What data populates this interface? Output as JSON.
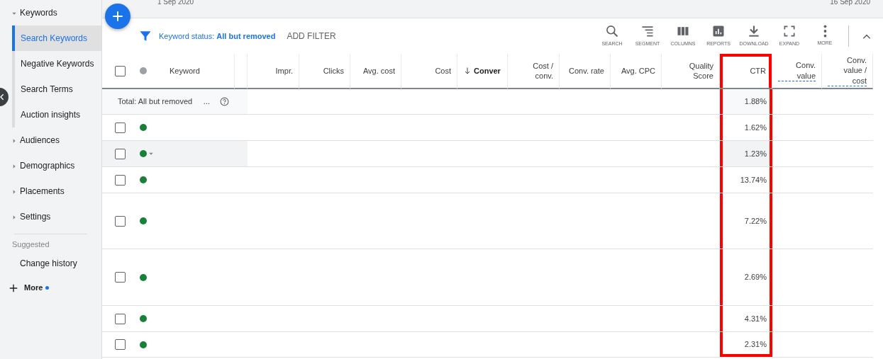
{
  "sidebar": {
    "items": [
      {
        "label": "Keywords",
        "expanded": true,
        "children": [
          {
            "label": "Search Keywords",
            "selected": true
          },
          {
            "label": "Negative Keywords",
            "selected": false
          },
          {
            "label": "Search Terms",
            "selected": false
          },
          {
            "label": "Auction insights",
            "selected": false
          }
        ]
      },
      {
        "label": "Audiences",
        "expanded": false
      },
      {
        "label": "Demographics",
        "expanded": false
      },
      {
        "label": "Placements",
        "expanded": false
      },
      {
        "label": "Settings",
        "expanded": false
      }
    ],
    "suggested_label": "Suggested",
    "suggested": [
      {
        "label": "Change history"
      }
    ],
    "more": {
      "label": "More",
      "new": true
    }
  },
  "date_range": {
    "start": "1 Sep 2020",
    "end": "16 Sep 2020"
  },
  "filter": {
    "text": "Keyword status: **All but removed**",
    "add_label": "ADD FILTER"
  },
  "toolbar": [
    {
      "label": "SEARCH",
      "kind": "search"
    },
    {
      "label": "SEGMENT",
      "kind": "segment"
    },
    {
      "label": "COLUMNS",
      "kind": "columns"
    },
    {
      "label": "REPORTS",
      "kind": "reports"
    },
    {
      "label": "DOWNLOAD",
      "kind": "download"
    },
    {
      "label": "EXPAND",
      "kind": "expand"
    },
    {
      "label": "MORE",
      "kind": "more"
    }
  ],
  "table": {
    "select_all": {
      "checked": false
    },
    "columns": [
      {
        "label": "Keyword",
        "highlighted": false
      },
      {
        "label": "Impr.",
        "highlighted": false
      },
      {
        "label": "Clicks",
        "highlighted": false
      },
      {
        "label": "Avg. cost",
        "highlighted": false
      },
      {
        "label": "Cost",
        "highlighted": false
      },
      {
        "label": "Conver",
        "sorted": true,
        "highlighted": false
      },
      {
        "label": "Cost / conv.",
        "highlighted": false
      },
      {
        "label": "Conv. rate",
        "highlighted": false
      },
      {
        "label": "Avg. CPC",
        "highlighted": false
      },
      {
        "label": "Quality Score",
        "highlighted": false
      },
      {
        "label": "CTR",
        "highlighted": true
      },
      {
        "label": "Conv. value",
        "dashed": true,
        "highlighted": false
      },
      {
        "label": "Conv. value / cost",
        "dashed": true,
        "highlighted": false
      }
    ],
    "total": {
      "label": "Total: All but removed",
      "more": "...",
      "ctr": "1.88%"
    },
    "rows": [
      {
        "ctr": "1.62%",
        "checked": false,
        "hovered": false,
        "color": "#188038"
      },
      {
        "ctr": "1.23%",
        "checked": false,
        "hovered": true,
        "color": "#188038"
      },
      {
        "ctr": "13.74%",
        "checked": false,
        "hovered": false,
        "color": "#188038"
      },
      {
        "ctr": "7.22%",
        "checked": false,
        "hovered": false,
        "color": "#188038"
      },
      {
        "ctr": "2.69%",
        "checked": false,
        "hovered": false,
        "color": "#188038"
      },
      {
        "ctr": "4.31%",
        "checked": false,
        "hovered": false,
        "color": "#188038"
      },
      {
        "ctr": "2.31%",
        "checked": false,
        "hovered": false,
        "color": "#188038"
      }
    ]
  }
}
